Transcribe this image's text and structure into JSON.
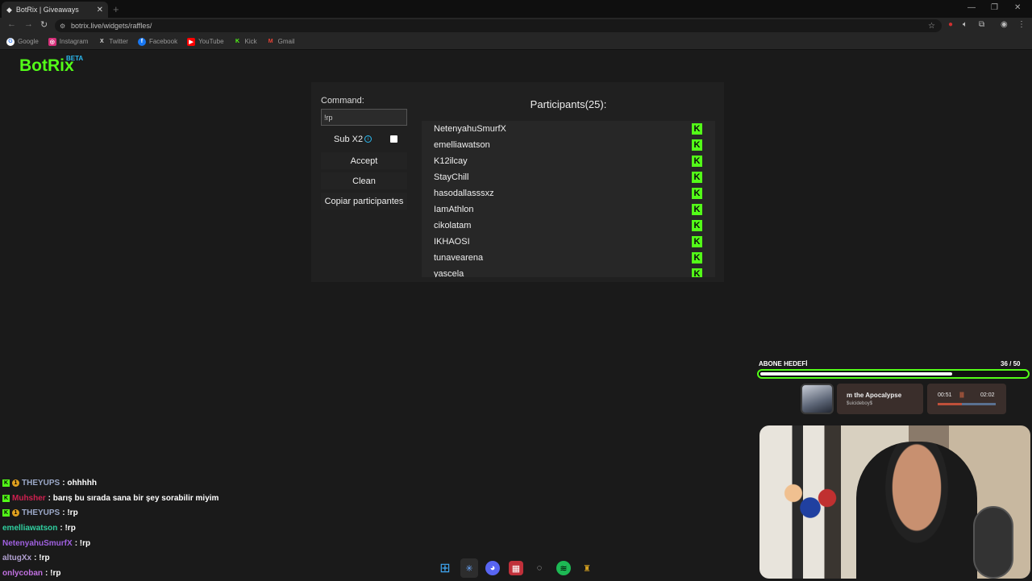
{
  "browser": {
    "tab_title": "BotRix | Giveaways",
    "url": "botrix.live/widgets/raffles/",
    "bookmarks": [
      "Google",
      "Instagram",
      "Twitter",
      "Facebook",
      "YouTube",
      "Kick",
      "Gmail"
    ]
  },
  "site": {
    "logo": "BotRix",
    "logo_badge": "BETA"
  },
  "raffle": {
    "command_label": "Command:",
    "command_value": "!rp",
    "subx2_label": "Sub X2",
    "subx2_checked": false,
    "accept_label": "Accept",
    "clean_label": "Clean",
    "copy_label": "Copiar participantes",
    "participants_title": "Participants(25):",
    "participants": [
      "NetenyahuSmurfX",
      "emelliawatson",
      "K12ilcay",
      "StayChill",
      "hasodallasssxz",
      "IamAthlon",
      "cikolatam",
      "IKHAOSI",
      "tunavearena",
      "yascela"
    ]
  },
  "overlay": {
    "goal_label": "ABONE HEDEFİ",
    "goal_count": "36  / 50",
    "goal_progress": 0.72,
    "song_title": "m the Apocalypse",
    "song_artist": "$uicideboy$",
    "time_elapsed": "00:51",
    "time_total": "02:02",
    "song_progress": 0.42
  },
  "chat": [
    {
      "user": "THEYUPS",
      "msg": ": ohhhhh",
      "color": "#9ba8c8",
      "badges": [
        "kick",
        "sub"
      ]
    },
    {
      "user": "Muhsher",
      "msg": ": barış bu sırada sana bir şey sorabilir miyim",
      "color": "#d02050",
      "badges": [
        "kick"
      ]
    },
    {
      "user": "THEYUPS",
      "msg": ": !rp",
      "color": "#9ba8c8",
      "badges": [
        "kick",
        "sub"
      ]
    },
    {
      "user": "emelliawatson",
      "msg": ": !rp",
      "color": "#30d0a0",
      "badges": []
    },
    {
      "user": "NetenyahuSmurfX",
      "msg": ": !rp",
      "color": "#a060e0",
      "badges": []
    },
    {
      "user": "altugXx",
      "msg": ": !rp",
      "color": "#b0a0d0",
      "badges": []
    },
    {
      "user": "onlycoban",
      "msg": ": !rp",
      "color": "#c070e0",
      "badges": []
    }
  ],
  "colors": {
    "kick_green": "#53fc18",
    "beta_blue": "#2ab9f0"
  }
}
